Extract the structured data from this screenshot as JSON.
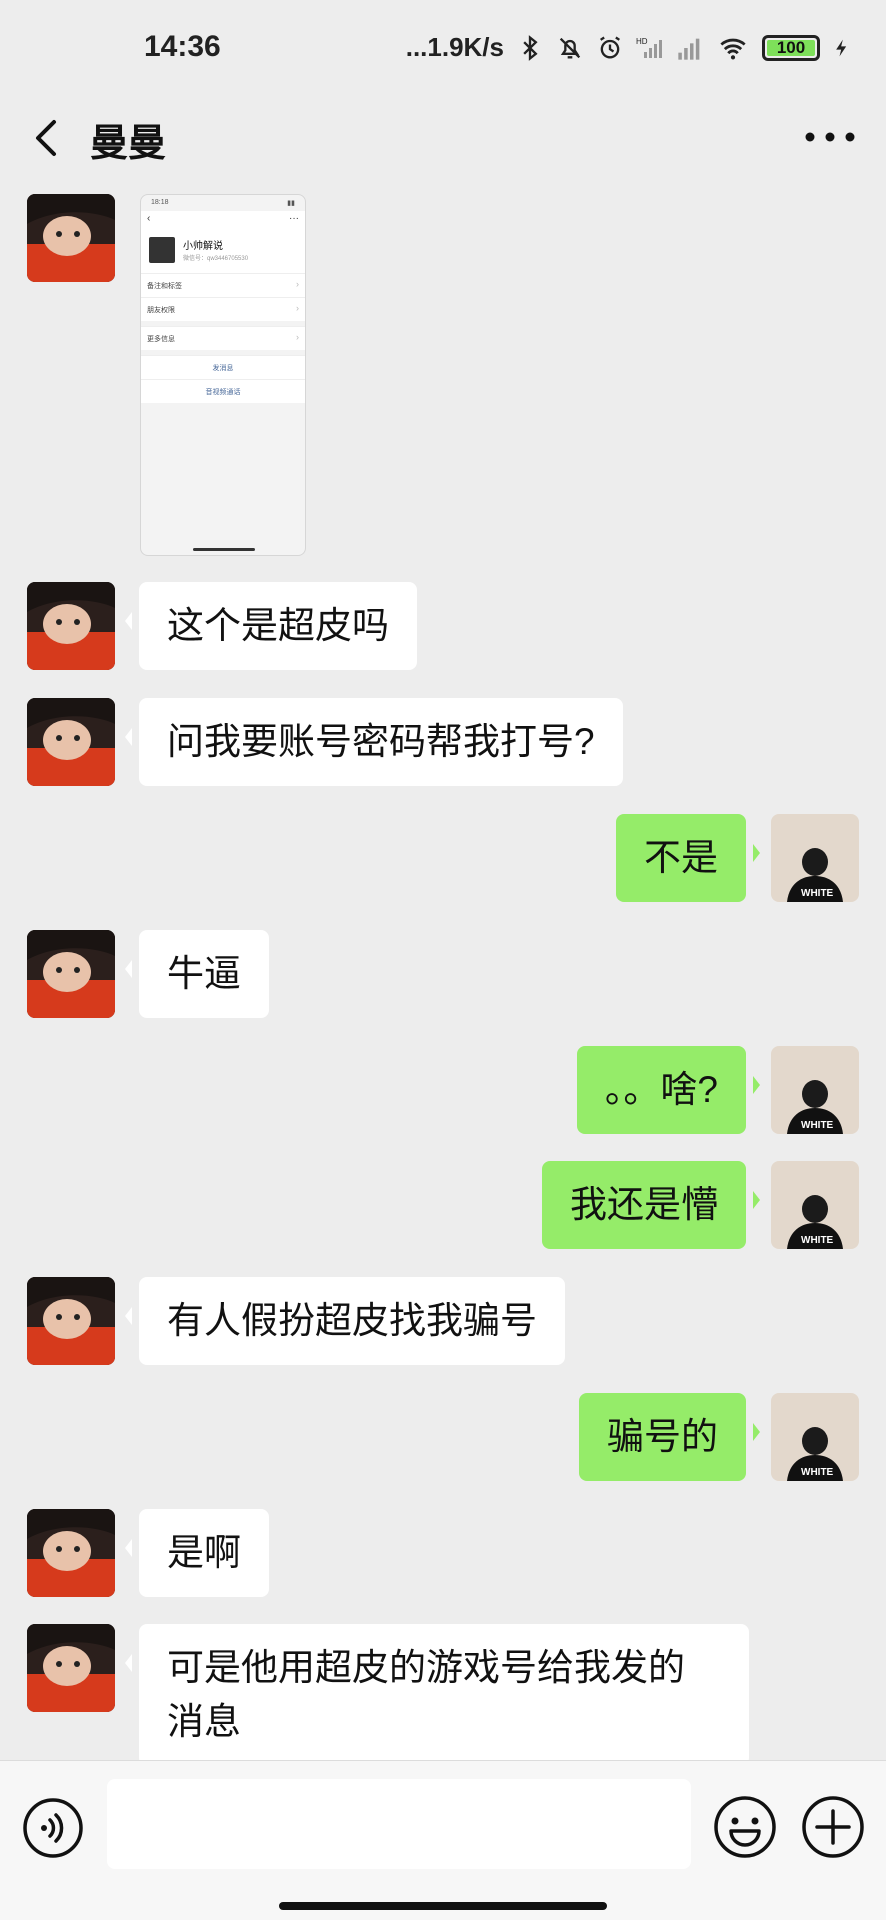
{
  "status_bar": {
    "time": "14:36",
    "network_speed": "...1.9K/s",
    "battery_level": "100",
    "icons": [
      "bluetooth-icon",
      "mute-icon",
      "alarm-icon",
      "hd-signal-icon",
      "signal-icon",
      "wifi-icon",
      "battery-icon",
      "charging-icon"
    ]
  },
  "header": {
    "title": "曼曼",
    "back_icon": "chevron-left-icon",
    "more_icon": "more-dots-icon"
  },
  "shared_image": {
    "status_time": "18:18",
    "name": "小帅解说",
    "wechat_id": "微信号：qw3446705530",
    "rows": [
      "备注和标签",
      "朋友权限",
      "更多信息"
    ],
    "buttons": [
      "发消息",
      "音视频通话"
    ]
  },
  "messages": [
    {
      "side": "in",
      "type": "image"
    },
    {
      "side": "in",
      "text": "这个是超皮吗"
    },
    {
      "side": "in",
      "text": "问我要账号密码帮我打号?"
    },
    {
      "side": "out",
      "text": "不是"
    },
    {
      "side": "in",
      "text": "牛逼"
    },
    {
      "side": "out",
      "text": "。。啥?"
    },
    {
      "side": "out",
      "text": "我还是懵"
    },
    {
      "side": "in",
      "text": "有人假扮超皮找我骗号"
    },
    {
      "side": "out",
      "text": "骗号的"
    },
    {
      "side": "in",
      "text": "是啊"
    },
    {
      "side": "in",
      "text": "可是他用超皮的游戏号给我发的消息"
    }
  ],
  "input_bar": {
    "voice_icon": "voice-icon",
    "emoji_icon": "emoji-icon",
    "plus_icon": "plus-icon",
    "input_value": ""
  },
  "colors": {
    "background": "#ededed",
    "incoming_bubble": "#ffffff",
    "outgoing_bubble": "#95ec69",
    "battery_fill": "#7ee05a"
  }
}
